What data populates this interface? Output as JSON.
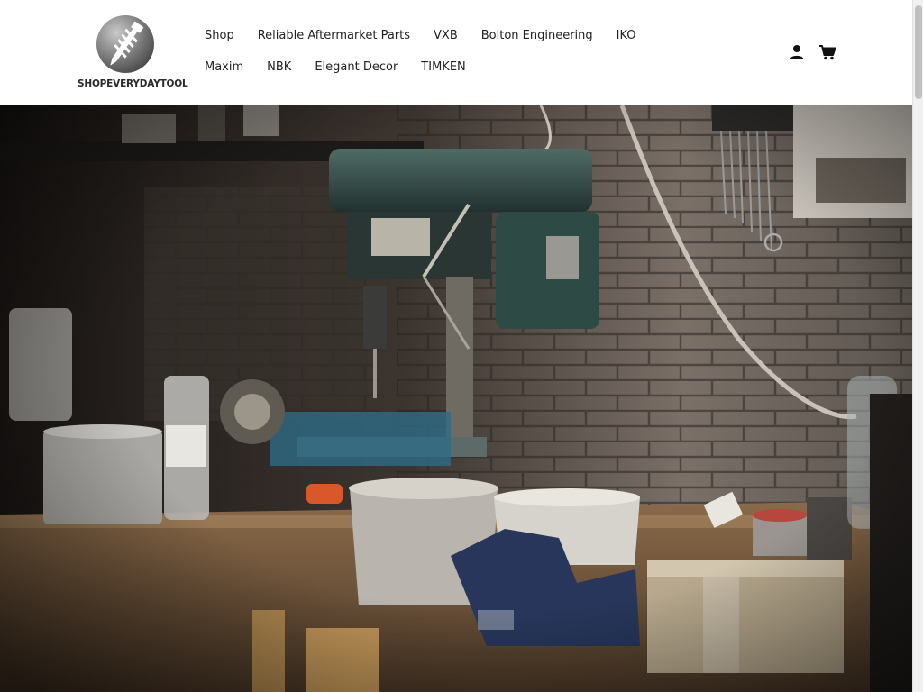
{
  "brand": {
    "name": "SHOPEVERYDAYTOOL",
    "logo_icon": "screw-bolt-logo-icon"
  },
  "nav": {
    "row1": [
      "Shop",
      "Reliable Aftermarket Parts",
      "VXB",
      "Bolton Engineering",
      "IKO"
    ],
    "row2": [
      "Maxim",
      "NBK",
      "Elegant Decor",
      "TIMKEN"
    ]
  },
  "header_icons": {
    "account": "user-icon",
    "cart": "cart-icon"
  },
  "hero": {
    "image": "workshop-drill-press-photo"
  },
  "colors": {
    "header_bg": "#ffffff",
    "text": "#222222",
    "brand_dark": "#2b2b2b"
  }
}
